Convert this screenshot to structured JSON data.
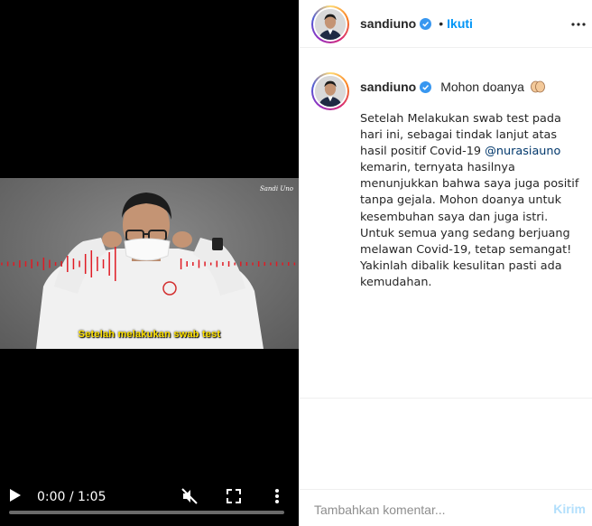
{
  "video": {
    "subtitle": "Setelah melakukan swab test",
    "watermark": "Sandi Uno",
    "time": "0:00 / 1:05",
    "progress_fraction": 0.0,
    "icons": {
      "play": "play-icon",
      "mute": "volume-muted-icon",
      "fullscreen": "fullscreen-icon",
      "menu": "more-vertical-icon"
    }
  },
  "header": {
    "username": "sandiuno",
    "separator": "•",
    "follow_label": "Ikuti",
    "more_icon": "more-horizontal-icon"
  },
  "caption": {
    "username": "sandiuno",
    "title": "Mohon doanya",
    "title_emoji": "folded-hands-emoji",
    "body_before_mention": "Setelah Melakukan swab test pada hari ini, sebagai tindak lanjut atas hasil positif Covid-19 ",
    "mention": "@nurasiauno",
    "body_after_mention": " kemarin, ternyata hasilnya menunjukkan bahwa saya juga positif tanpa gejala. Mohon doanya untuk kesembuhan saya dan juga istri. Untuk semua yang sedang berjuang melawan Covid-19, tetap semangat! Yakinlah dibalik kesulitan pasti ada kemudahan."
  },
  "comment": {
    "placeholder": "Tambahkan komentar...",
    "post_label": "Kirim"
  },
  "colors": {
    "accent": "#0095f6",
    "post_disabled": "#b2dffc",
    "mention": "#00376b",
    "verified": "#3897f0",
    "waveform": "#e01b24",
    "subtitle": "#ffe200"
  }
}
